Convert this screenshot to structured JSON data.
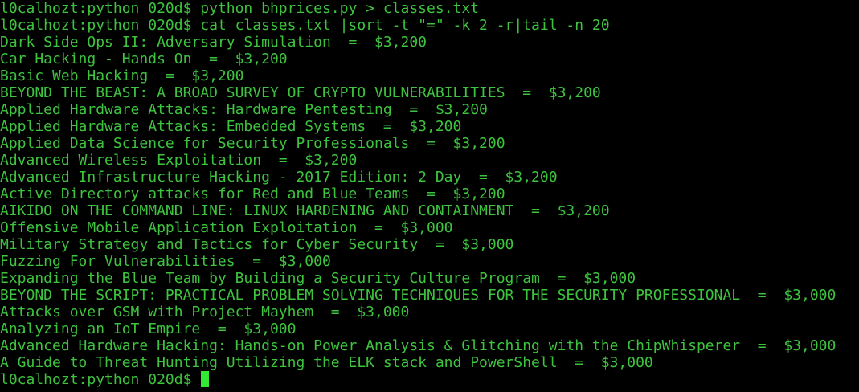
{
  "colors": {
    "background": "#000000",
    "text": "#3ec33e",
    "cursor": "#33e833"
  },
  "terminal": {
    "lines": [
      {
        "prompt": "l0calhozt:python 020d$ ",
        "command": "python bhprices.py > classes.txt"
      },
      {
        "prompt": "l0calhozt:python 020d$ ",
        "command": "cat classes.txt |sort -t \"=\" -k 2 -r|tail -n 20"
      }
    ],
    "output": [
      "Dark Side Ops II: Adversary Simulation  =  $3,200",
      "Car Hacking - Hands On  =  $3,200",
      "Basic Web Hacking  =  $3,200",
      "BEYOND THE BEAST: A BROAD SURVEY OF CRYPTO VULNERABILITIES  =  $3,200",
      "Applied Hardware Attacks: Hardware Pentesting  =  $3,200",
      "Applied Hardware Attacks: Embedded Systems  =  $3,200",
      "Applied Data Science for Security Professionals  =  $3,200",
      "Advanced Wireless Exploitation  =  $3,200",
      "Advanced Infrastructure Hacking - 2017 Edition: 2 Day  =  $3,200",
      "Active Directory attacks for Red and Blue Teams  =  $3,200",
      "AIKIDO ON THE COMMAND LINE: LINUX HARDENING AND CONTAINMENT  =  $3,200",
      "Offensive Mobile Application Exploitation  =  $3,000",
      "Military Strategy and Tactics for Cyber Security  =  $3,000",
      "Fuzzing For Vulnerabilities  =  $3,000",
      "Expanding the Blue Team by Building a Security Culture Program  =  $3,000",
      "BEYOND THE SCRIPT: PRACTICAL PROBLEM SOLVING TECHNIQUES FOR THE SECURITY PROFESSIONAL  =  $3,000",
      "Attacks over GSM with Project Mayhem  =  $3,000",
      "Analyzing an IoT Empire  =  $3,000",
      "Advanced Hardware Hacking: Hands-on Power Analysis & Glitching with the ChipWhisperer  =  $3,000",
      "A Guide to Threat Hunting Utilizing the ELK stack and PowerShell  =  $3,000"
    ],
    "final_prompt": "l0calhozt:python 020d$ "
  }
}
